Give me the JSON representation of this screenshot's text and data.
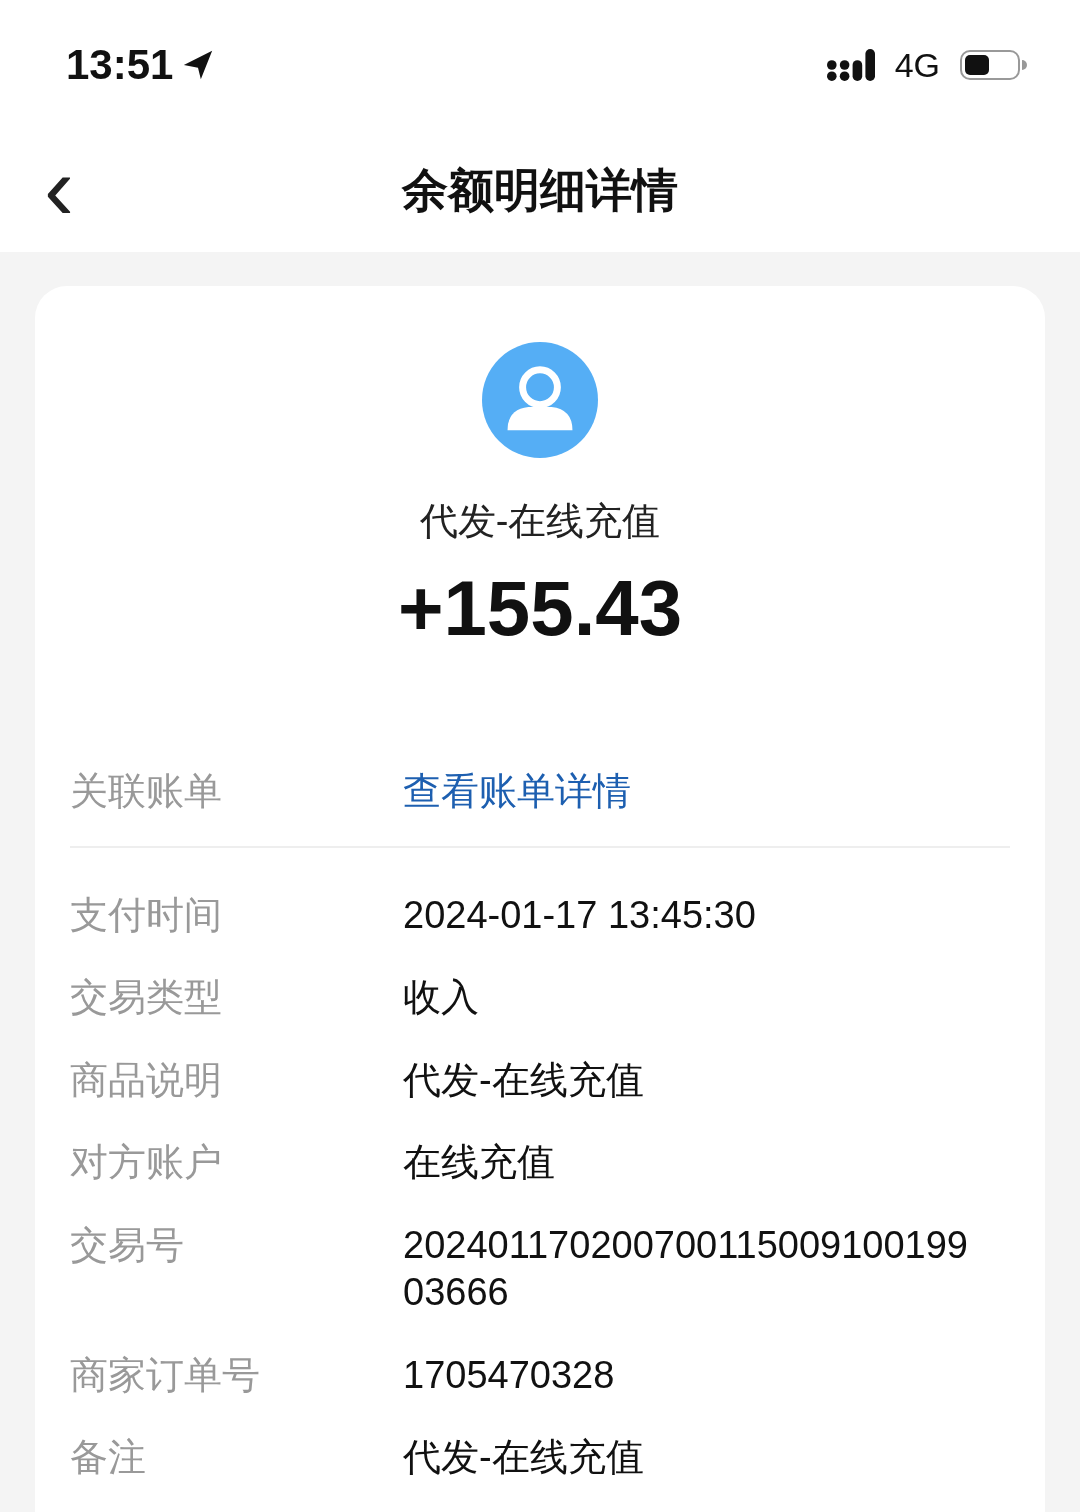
{
  "status_bar": {
    "time": "13:51",
    "network": "4G"
  },
  "nav_bar": {
    "back": "‹",
    "title": "余额明细详情"
  },
  "summary": {
    "name": "代发-在线充值",
    "amount": "+155.43"
  },
  "link_row": {
    "label": "关联账单",
    "link": "查看账单详情"
  },
  "details": [
    {
      "label": "支付时间",
      "value": "2024-01-17 13:45:30"
    },
    {
      "label": "交易类型",
      "value": "收入"
    },
    {
      "label": "商品说明",
      "value": "代发-在线充值"
    },
    {
      "label": "对方账户",
      "value": "在线充值"
    },
    {
      "label": "交易号",
      "value": "20240117020070011500910019903666"
    },
    {
      "label": "商家订单号",
      "value": "1705470328"
    },
    {
      "label": "备注",
      "value": "代发-在线充值"
    }
  ]
}
